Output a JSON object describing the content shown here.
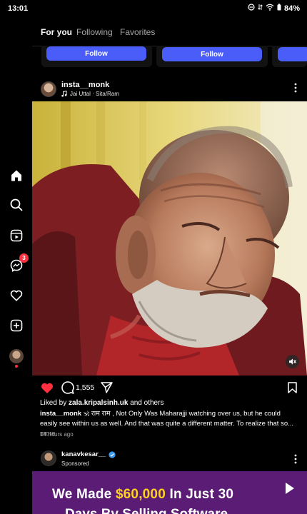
{
  "status": {
    "time": "13:01",
    "battery": "84%"
  },
  "sidebar": {
    "messages_badge": "3"
  },
  "tabs": [
    {
      "label": "For you"
    },
    {
      "label": "Following"
    },
    {
      "label": "Favorites"
    }
  ],
  "suggestions": {
    "follow_label": "Follow"
  },
  "post": {
    "username": "insta__monk",
    "audio": "Jai Uttal · Sita/Ram",
    "comment_count": "1,555",
    "liked_by_prefix": "Liked by",
    "liked_by_user": "zala.kripalsinh.uk",
    "liked_by_suffix": "and others",
    "caption_user": "insta__monk",
    "caption_text": "🕉 राम राम , Not Only Was Maharajji watching over us, but he could easily see within us as well. And that was quite a different matter. To realize that so...",
    "more_label": "more",
    "time_ago": "14 hours ago"
  },
  "ad": {
    "username": "kanavkesar__",
    "sponsored": "Sponsored",
    "headline_pre": "We Made",
    "headline_highlight": "$60,000",
    "headline_post": "In Just 30",
    "headline_line2": "Days By Selling Software"
  },
  "colors": {
    "accent": "#4a5df9",
    "like": "#ff3040",
    "ad_bg": "#5a1c75",
    "ad_highlight": "#ffd21f"
  }
}
